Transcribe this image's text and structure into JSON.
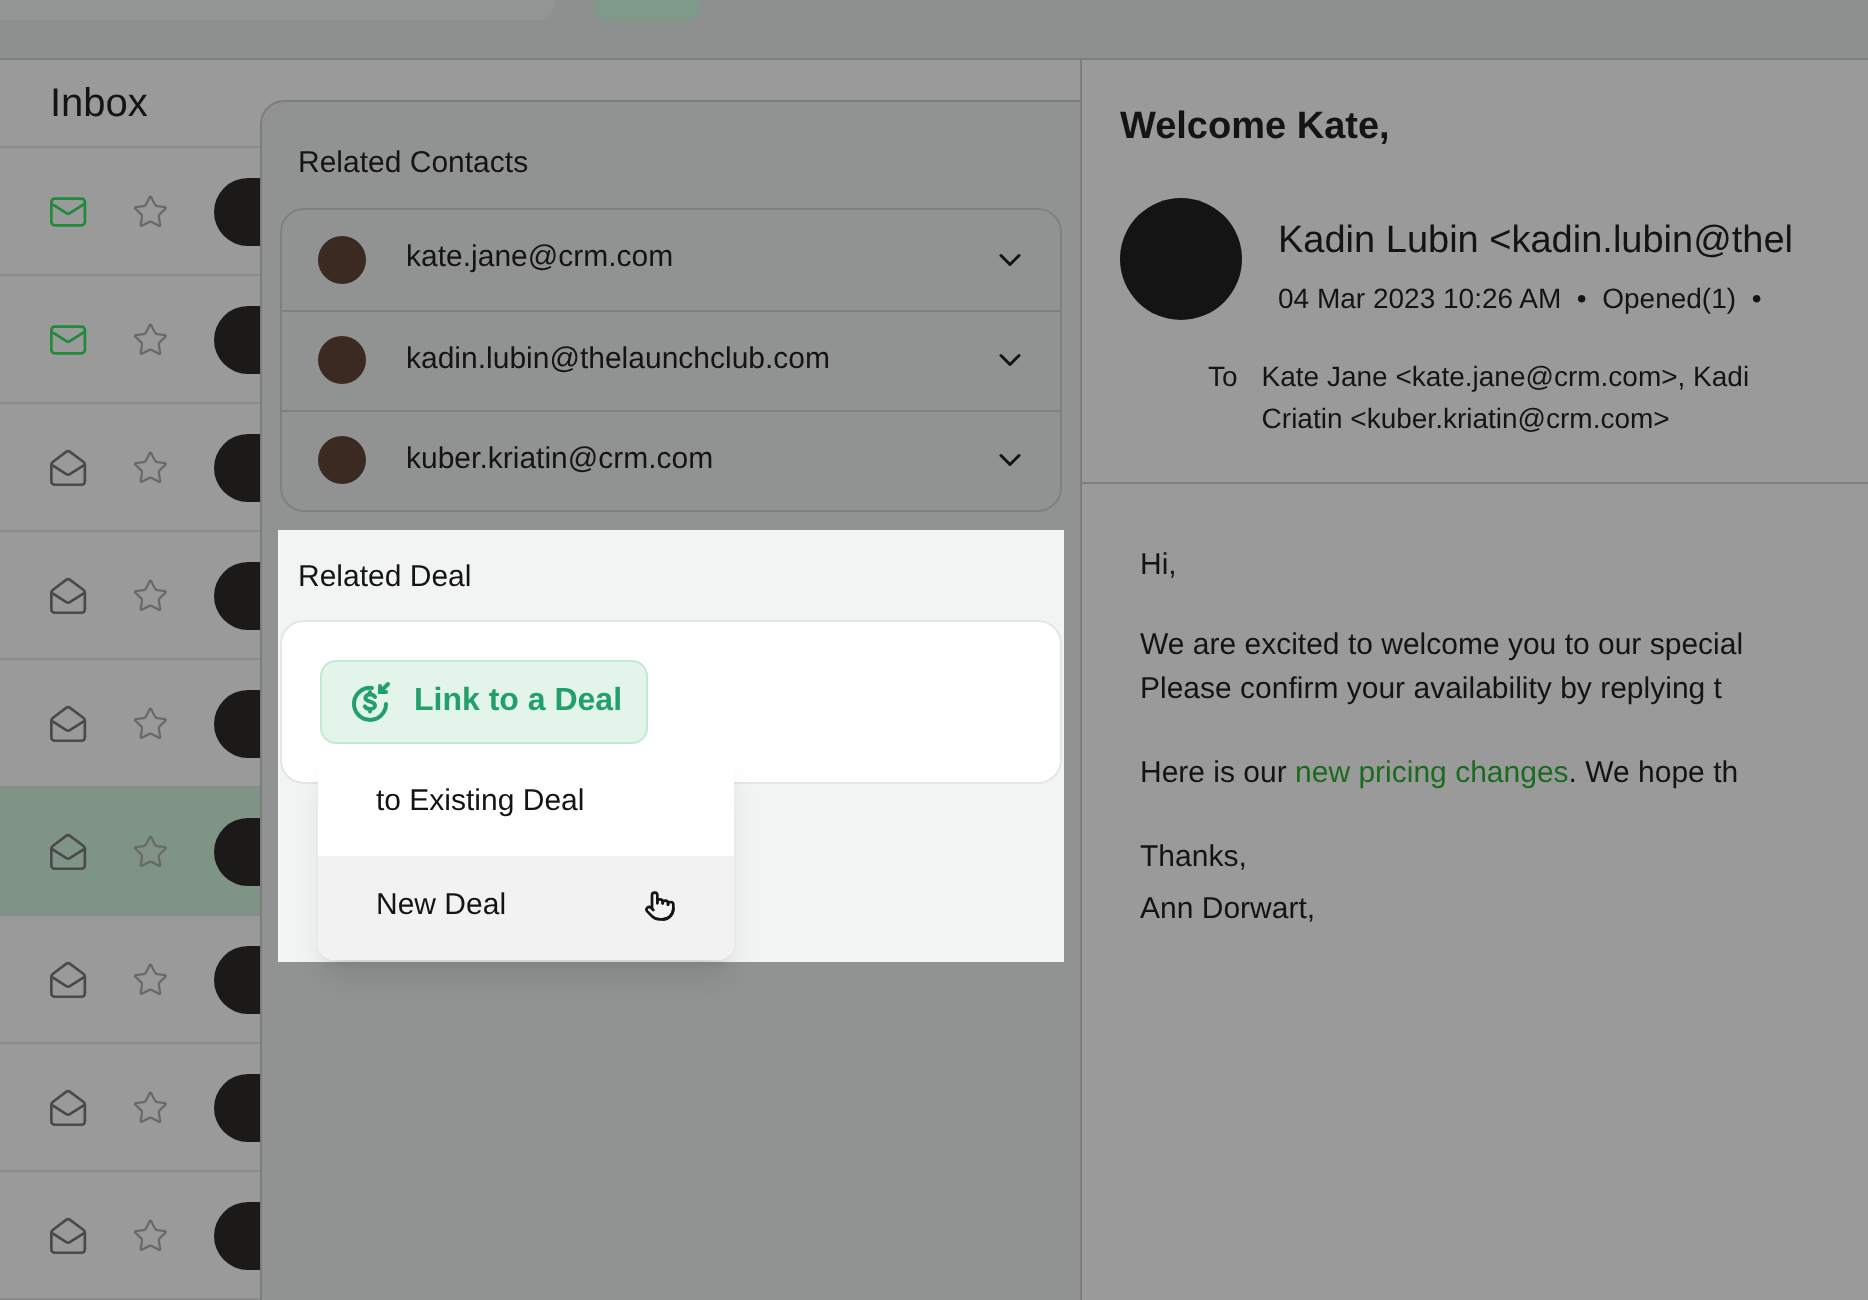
{
  "inbox": {
    "title": "Inbox",
    "rows": [
      {
        "unread": true,
        "selected": false
      },
      {
        "unread": true,
        "selected": false
      },
      {
        "unread": false,
        "selected": false
      },
      {
        "unread": false,
        "selected": false
      },
      {
        "unread": false,
        "selected": false
      },
      {
        "unread": false,
        "selected": true
      },
      {
        "unread": false,
        "selected": false
      },
      {
        "unread": false,
        "selected": false
      },
      {
        "unread": false,
        "selected": false
      }
    ]
  },
  "related_contacts": {
    "title": "Related Contacts",
    "contacts": [
      {
        "email": "kate.jane@crm.com"
      },
      {
        "email": "kadin.lubin@thelaunchclub.com"
      },
      {
        "email": "kuber.kriatin@crm.com"
      }
    ]
  },
  "related_deal": {
    "title": "Related Deal",
    "button": "Link to a Deal",
    "menu": [
      {
        "label": "to Existing Deal",
        "selected": false
      },
      {
        "label": "New Deal",
        "selected": true
      }
    ]
  },
  "email": {
    "subject": "Welcome Kate,",
    "sender": "Kadin Lubin <kadin.lubin@thel",
    "meta": "04 Mar 2023 10:26 AM  •  Opened(1)  •",
    "to_label": "To",
    "to_lines": [
      "Kate Jane <kate.jane@crm.com>, Kadi",
      "Criatin <kuber.kriatin@crm.com>"
    ],
    "greeting": "Hi,",
    "paragraph_lines": [
      "We are excited to welcome you to our special",
      "Please confirm your availability by replying t"
    ],
    "pricing": {
      "before": "Here is our ",
      "link": "new pricing changes",
      "after": ". We hope th"
    },
    "signoff": [
      "Thanks,",
      "Ann Dorwart,"
    ]
  }
}
